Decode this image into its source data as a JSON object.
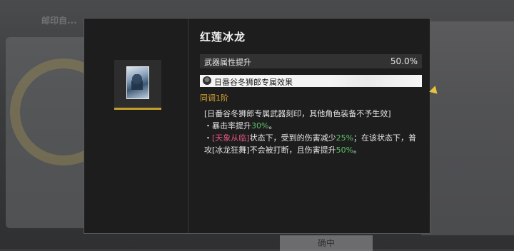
{
  "background": {
    "title": "邮印自...",
    "bottom_button": "确中"
  },
  "dialog": {
    "title": "红莲冰龙",
    "stat": {
      "name": "武器属性提升",
      "value": "50.0%"
    },
    "exclusive": {
      "label": "日番谷冬狮郎专属效果"
    },
    "sync_level": "同调1阶",
    "description": {
      "line1": "[日番谷冬狮郎专属武器刻印，其他角色装备不予生效]",
      "line2_prefix": "・暴击率提升",
      "line2_value": "30%",
      "line2_suffix": "。",
      "line3_bullet": "・",
      "line3_tag": "[天象从临]",
      "line3_mid": "状态下，受到的伤害减少",
      "line3_value": "25%",
      "line3_suffix": "；在该状态下，普",
      "line4_prefix": "攻[冰龙狂舞]不会被打断，且伤害提升",
      "line4_value": "50%",
      "line4_suffix": "。"
    }
  },
  "colors": {
    "accent_gold": "#c4a02a",
    "highlight_green": "#5ec56a",
    "highlight_pink": "#e0577d"
  }
}
